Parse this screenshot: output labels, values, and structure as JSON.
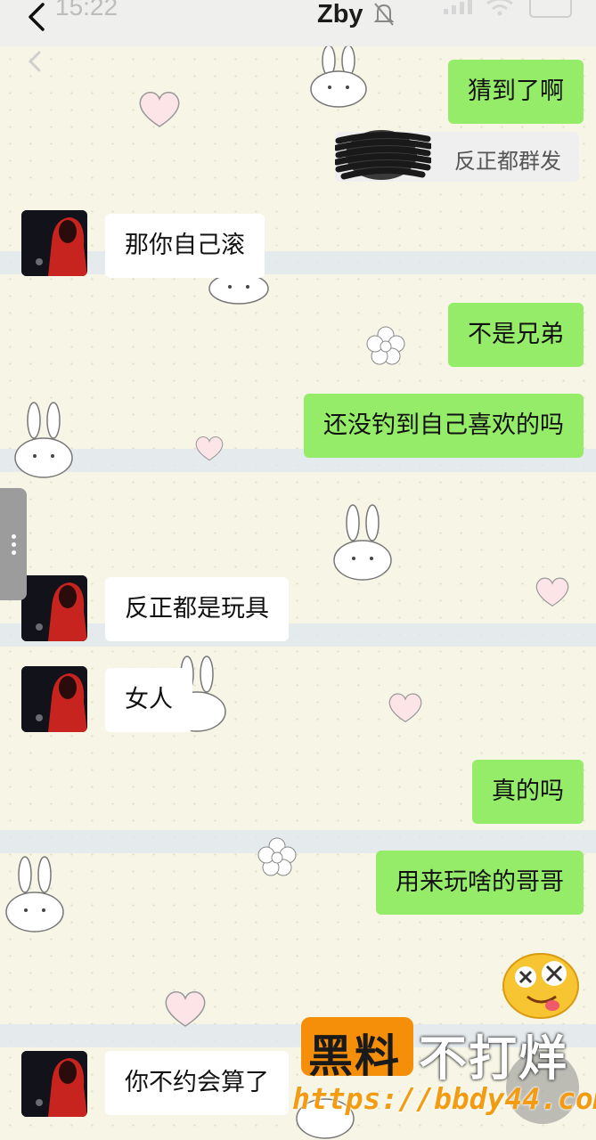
{
  "status_bar": {
    "time": "15:22"
  },
  "header": {
    "title": "Zby"
  },
  "quote": {
    "text": "反正都群发"
  },
  "messages": [
    {
      "side": "out",
      "text": "猜到了啊"
    },
    {
      "side": "in",
      "text": "那你自己滚"
    },
    {
      "side": "out",
      "text": "不是兄弟"
    },
    {
      "side": "out",
      "text": "还没钓到自己喜欢的吗"
    },
    {
      "side": "out",
      "text": "❤"
    },
    {
      "side": "in",
      "text": "反正都是玩具"
    },
    {
      "side": "in",
      "text": "女人"
    },
    {
      "side": "out",
      "text": "真的吗"
    },
    {
      "side": "out",
      "text": "用来玩啥的哥哥"
    },
    {
      "side": "in",
      "text": "你不约会算了"
    }
  ],
  "watermark": {
    "brand": "黑料",
    "slogan": "不打烊",
    "url": "https://bbdy44.com"
  },
  "colors": {
    "outgoing_bubble": "#95ec69",
    "incoming_bubble": "#ffffff",
    "heart": "#f23a5c",
    "watermark": "#f58f0a"
  },
  "icons": [
    "back-arrow-icon",
    "bell-muted-icon",
    "signal-icon",
    "wifi-icon",
    "battery-icon",
    "heart-icon",
    "emoji-sticker-icon"
  ]
}
